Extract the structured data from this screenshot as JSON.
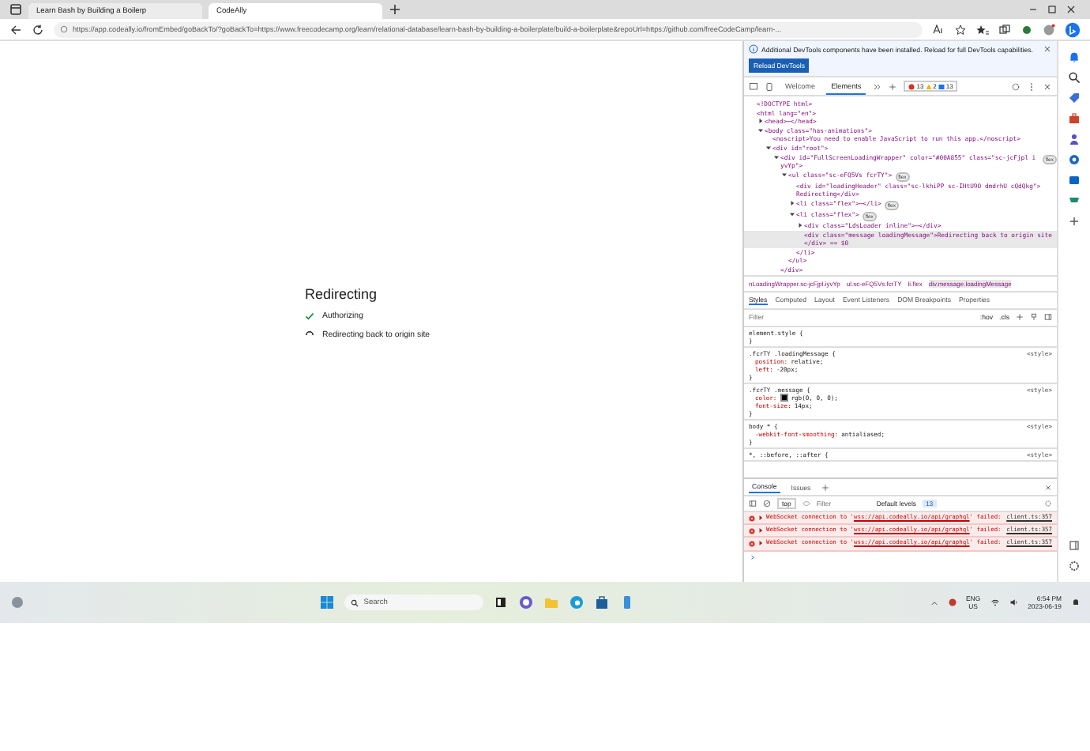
{
  "browser": {
    "tabs": [
      {
        "title": "Learn Bash by Building a Boilerp",
        "selected": false
      },
      {
        "title": "CodeAlly",
        "selected": true
      }
    ],
    "url": "https://app.codeally.io/fromEmbed/goBackTo/?goBackTo=https://www.freecodecamp.org/learn/relational-database/learn-bash-by-building-a-boilerplate/build-a-boilerplate&repoUrl=https://github.com/freeCodeCamp/learn-..."
  },
  "page": {
    "heading": "Redirecting",
    "steps": [
      {
        "label": "Authorizing",
        "kind": "done"
      },
      {
        "label": "Redirecting back to origin site",
        "kind": "loading"
      }
    ]
  },
  "devtools": {
    "notice": "Additional DevTools components have been installed. Reload for full DevTools capabilities.",
    "reload_button": "Reload DevTools",
    "tabs": [
      {
        "label": "Welcome",
        "selected": false
      },
      {
        "label": "Elements",
        "selected": true
      }
    ],
    "error_count": "13",
    "warning_count": "2",
    "info_count": "13",
    "dom_tree": [
      {
        "text": "<!DOCTYPE html>"
      },
      {
        "text": "<html lang=\"en\">",
        "children": [
          {
            "text": "<head>⋯</head>",
            "expanded": false
          },
          {
            "text": "<body class=\"has-animations\">",
            "expanded": true,
            "children": [
              {
                "text": "<noscript>You need to enable JavaScript to run this app.</noscript>"
              },
              {
                "text": "<div id=\"root\">",
                "expanded": true,
                "children": [
                  {
                    "text": "<div id=\"FullScreenLoadingWrapper\" color=\"#00A855\" class=\"sc-jcFjpl iyvYp\">",
                    "badge": "flex",
                    "expanded": true,
                    "children": [
                      {
                        "text": "<ul class=\"sc-eFQ5Vs fcrTY\">",
                        "badge": "flex",
                        "expanded": true,
                        "children": [
                          {
                            "text": "<div id=\"loadingHeader\" class=\"sc-lkhiPP sc-IHtU9O dmdrhU cQdQkg\">"
                          },
                          {
                            "text": "Redirecting</div>"
                          },
                          {
                            "text": "<li class=\"flex\">⋯</li>",
                            "badge": "flex",
                            "expanded": false
                          },
                          {
                            "text": "<li class=\"flex\">",
                            "badge": "flex",
                            "expanded": true,
                            "children": [
                              {
                                "text": "<div class=\"LdsLoader inline\">⋯</div>",
                                "expanded": false
                              },
                              {
                                "text": "<div class=\"message loadingMessage\">Redirecting back to origin site",
                                "selected": true
                              },
                              {
                                "text": "</div> == $0",
                                "selected": true
                              }
                            ]
                          },
                          {
                            "text": "</li>"
                          }
                        ]
                      },
                      {
                        "text": "</ul>"
                      }
                    ]
                  },
                  {
                    "text": "</div>"
                  }
                ]
              }
            ]
          }
        ]
      }
    ],
    "breadcrumbs": [
      {
        "label": "nLoadingWrapper.sc-jcFjpl.iyvYp",
        "selected": false
      },
      {
        "label": "ul.sc-eFQ5Vs.fcrTY",
        "selected": false
      },
      {
        "label": "li.flex",
        "selected": false
      },
      {
        "label": "div.message.loadingMessage",
        "selected": true
      }
    ],
    "styles_tabs": [
      {
        "label": "Styles",
        "selected": true
      },
      {
        "label": "Computed",
        "selected": false
      },
      {
        "label": "Layout",
        "selected": false
      },
      {
        "label": "Event Listeners",
        "selected": false
      },
      {
        "label": "DOM Breakpoints",
        "selected": false
      },
      {
        "label": "Properties",
        "selected": false
      }
    ],
    "styles_filter": {
      "placeholder": "Filter"
    },
    "hov": ":hov",
    "cls": ".cls",
    "rules": [
      {
        "selector": "element.style {",
        "close": "}"
      },
      {
        "selector": ".fcrTY .loadingMessage {",
        "source": "<style>",
        "declarations": [
          {
            "kind": "plain",
            "property": "position:",
            "value": "relative;"
          },
          {
            "kind": "plain",
            "property": "left:",
            "value": "-20px;"
          }
        ],
        "close": "}"
      },
      {
        "selector": ".fcrTY .message {",
        "source": "<style>",
        "declarations": [
          {
            "kind": "color",
            "property": "color:",
            "value": "rgb(0, 0, 0);"
          },
          {
            "kind": "plain",
            "property": "font-size:",
            "value": "14px;"
          }
        ],
        "close": "}"
      },
      {
        "selector": "body * {",
        "source": "<style>",
        "declarations": [
          {
            "kind": "plain",
            "property": "-webkit-font-smoothing:",
            "value": "antialiased;"
          }
        ],
        "close": "}"
      },
      {
        "selector": "*, ::before, ::after {",
        "source": "<style>"
      }
    ],
    "drawer_tabs": [
      {
        "label": "Console",
        "selected": true
      },
      {
        "label": "Issues",
        "selected": false
      }
    ],
    "console_context": "top",
    "console_filter": {
      "placeholder": "Filter"
    },
    "levels": "Default levels",
    "console_count": "13",
    "messages": [
      {
        "prefix": "WebSocket connection to '",
        "url": "wss://api.codeally.io/api/graphql",
        "suffix": "' failed:",
        "source": "client.ts:357"
      },
      {
        "prefix": "WebSocket connection to '",
        "url": "wss://api.codeally.io/api/graphql",
        "suffix": "' failed:",
        "source": "client.ts:357"
      },
      {
        "prefix": "WebSocket connection to '",
        "url": "wss://api.codeally.io/api/graphql",
        "suffix": "' failed:",
        "source": "client.ts:357"
      }
    ]
  },
  "taskbar": {
    "search": {
      "placeholder": "Search"
    },
    "language": "ENG",
    "region": "US",
    "time": "6:54 PM",
    "date": "2023-06-19"
  }
}
